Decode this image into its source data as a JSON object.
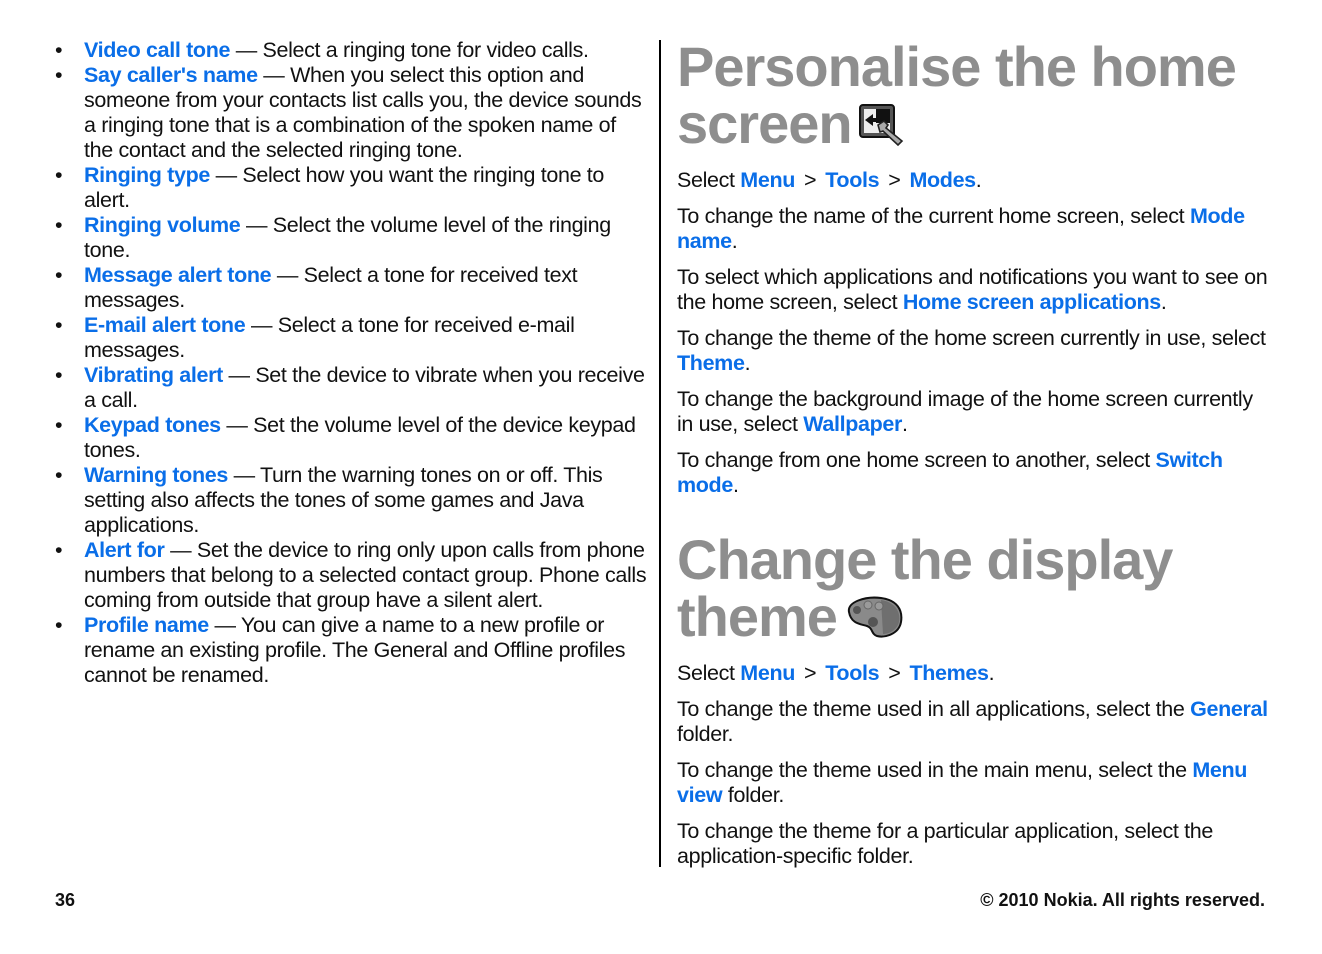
{
  "left_column": {
    "items": [
      {
        "term": "Video call tone",
        "desc": " — Select a ringing tone for video calls."
      },
      {
        "term": "Say caller's name",
        "desc": " — When you select this option and someone from your contacts list calls you, the device sounds a ringing tone that is a combination of the spoken name of the contact and the selected ringing tone."
      },
      {
        "term": "Ringing type",
        "desc": " — Select how you want the ringing tone to alert."
      },
      {
        "term": "Ringing volume",
        "desc": " — Select the volume level of the ringing tone."
      },
      {
        "term": "Message alert tone",
        "desc": " — Select a tone for received text messages."
      },
      {
        "term": "E-mail alert tone",
        "desc": " — Select a tone for received e-mail messages."
      },
      {
        "term": "Vibrating alert",
        "desc": " — Set the device to vibrate when you receive a call."
      },
      {
        "term": "Keypad tones",
        "desc": " — Set the volume level of the device keypad tones."
      },
      {
        "term": "Warning tones",
        "desc": " — Turn the warning tones on or off. This setting also affects the tones of some games and Java applications."
      },
      {
        "term": "Alert for",
        "desc": " — Set the device to ring only upon calls from phone numbers that belong to a selected contact group. Phone calls coming from outside that group have a silent alert."
      },
      {
        "term": "Profile name",
        "desc": " — You can give a name to a new profile or rename an existing profile. The General and Offline profiles cannot be renamed."
      }
    ]
  },
  "section1": {
    "title": "Personalise the home screen",
    "icon": "home-screen-settings-icon",
    "path": {
      "prefix": "Select ",
      "items": [
        "Menu",
        "Tools",
        "Modes"
      ],
      "sep": ">",
      "suffix": "."
    },
    "paragraphs": [
      {
        "pre": "To change the name of the current home screen, select ",
        "link": "Mode name",
        "post": "."
      },
      {
        "pre": "To select which applications and notifications you want to see on the home screen, select ",
        "link": "Home screen applications",
        "post": "."
      },
      {
        "pre": "To change the theme of the home screen currently in use, select ",
        "link": "Theme",
        "post": "."
      },
      {
        "pre": "To change the background image of the home screen currently in use, select ",
        "link": "Wallpaper",
        "post": "."
      },
      {
        "pre": "To change from one home screen to another, select ",
        "link": "Switch mode",
        "post": "."
      }
    ]
  },
  "section2": {
    "title": "Change the display theme",
    "icon": "palette-icon",
    "path": {
      "prefix": "Select ",
      "items": [
        "Menu",
        "Tools",
        "Themes"
      ],
      "sep": ">",
      "suffix": "."
    },
    "paragraphs": [
      {
        "pre": "To change the theme used in all applications, select the ",
        "link": "General",
        "post": " folder."
      },
      {
        "pre": "To change the theme used in the main menu, select the ",
        "link": "Menu view",
        "post": " folder."
      },
      {
        "pre": "To change the theme for a particular application, select the application-specific folder.",
        "link": "",
        "post": ""
      }
    ]
  },
  "footer": {
    "page_number": "36",
    "copyright": "© 2010 Nokia. All rights reserved."
  },
  "colors": {
    "link": "#0a6ee8",
    "heading": "#8e8e8e"
  }
}
